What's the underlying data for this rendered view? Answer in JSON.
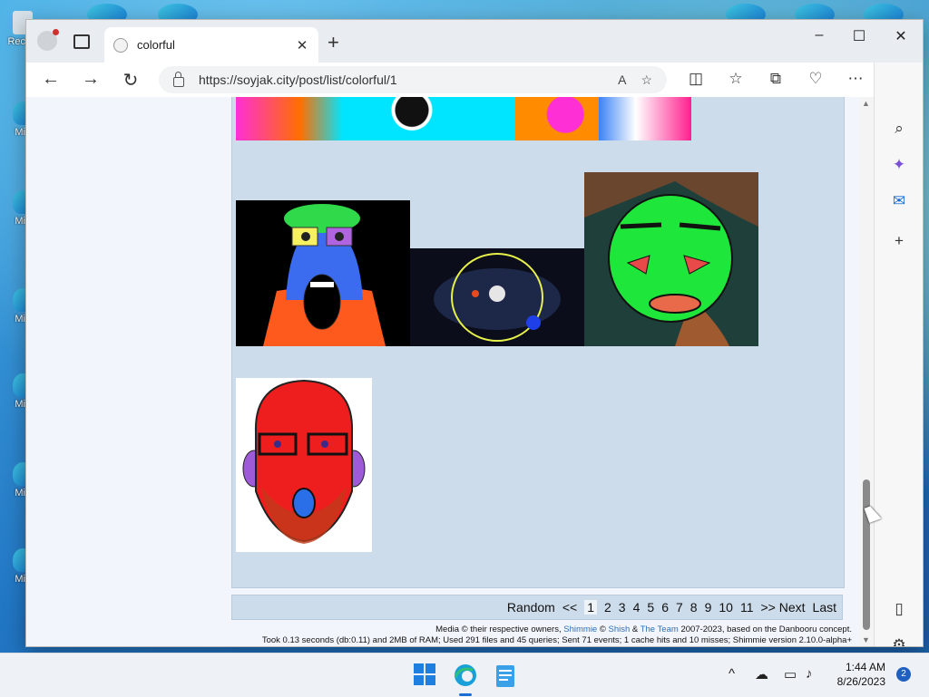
{
  "desktop": {
    "icons": [
      {
        "label": "Rec"
      },
      {
        "label": "Mi"
      },
      {
        "label": "Mi"
      },
      {
        "label": "Mi"
      },
      {
        "label": "Mi"
      },
      {
        "label": "Mi"
      },
      {
        "label": "Mi"
      }
    ]
  },
  "browser": {
    "tab_title": "colorful",
    "url": "https://soyjak.city/post/list/colorful/1",
    "icons": {
      "profile": "profile-icon",
      "tab_actions": "tab-actions-icon",
      "favicon": "page-favicon-icon",
      "close_tab": "close-icon",
      "new_tab": "plus-icon",
      "back": "back-arrow-icon",
      "forward": "forward-arrow-icon",
      "refresh": "refresh-icon",
      "lock": "lock-icon",
      "read_aloud": "read-aloud-icon",
      "favorite": "star-icon",
      "split": "split-screen-icon",
      "favorites": "favorites-icon",
      "collections": "collections-icon",
      "health": "browser-essentials-icon",
      "more": "more-icon",
      "copilot": "copilot-icon"
    },
    "window_controls": {
      "minimize": "–",
      "maximize": "☐",
      "close": "✕"
    },
    "sidebar_icons": [
      "search-icon",
      "copilot-apps-icon",
      "outlook-icon",
      "plus-icon",
      "panel-icon",
      "settings-icon"
    ]
  },
  "page": {
    "paginator": {
      "random": "Random",
      "prev": "<<",
      "pages": [
        "1",
        "2",
        "3",
        "4",
        "5",
        "6",
        "7",
        "8",
        "9",
        "10",
        "11"
      ],
      "current": "1",
      "next": ">> Next",
      "last": "Last"
    },
    "footer": {
      "line1_prefix": "Media © their respective owners,",
      "shimmie": "Shimmie",
      "copyright": "©",
      "shish": "Shish",
      "amp": "&",
      "team": "The Team",
      "line1_suffix": "2007-2023, based on the Danbooru concept.",
      "line2": "Took 0.13 seconds (db:0.11) and 2MB of RAM; Used 291 files and 45 queries; Sent 71 events; 1 cache hits and 10 misses; Shimmie version 2.10.0-alpha+"
    }
  },
  "taskbar": {
    "icons": [
      "windows-start-icon",
      "edge-icon",
      "notepad-icon"
    ],
    "tray": [
      "chevron-up-icon",
      "onedrive-off-icon",
      "network-icon",
      "volume-icon"
    ],
    "time": "1:44 AM",
    "date": "8/26/2023",
    "notifications": "2"
  }
}
